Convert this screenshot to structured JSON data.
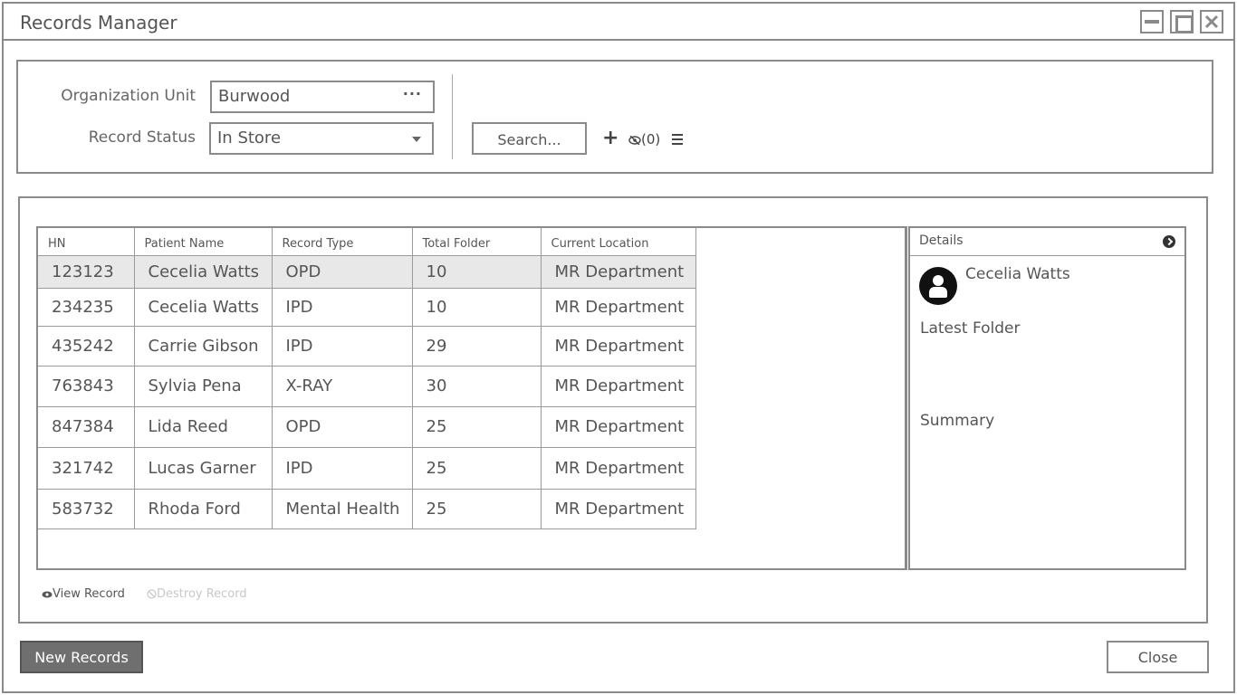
{
  "window": {
    "title": "Records Manager"
  },
  "filters": {
    "org_unit_label": "Organization Unit",
    "org_unit_value": "Burwood",
    "record_status_label": "Record Status",
    "record_status_value": "In Store",
    "search_label": "Search...",
    "hidden_count": "(0)"
  },
  "grid": {
    "columns": [
      "HN",
      "Patient Name",
      "Record Type",
      "Total Folder",
      "Current Location"
    ],
    "rows": [
      {
        "hn": "123123",
        "name": "Cecelia Watts",
        "type": "OPD",
        "folders": "10",
        "location": "MR Department",
        "selected": true
      },
      {
        "hn": "234235",
        "name": "Cecelia Watts",
        "type": "IPD",
        "folders": "10",
        "location": "MR Department"
      },
      {
        "hn": "435242",
        "name": "Carrie Gibson",
        "type": "IPD",
        "folders": "29",
        "location": "MR Department"
      },
      {
        "hn": "763843",
        "name": "Sylvia Pena",
        "type": "X-RAY",
        "folders": "30",
        "location": "MR Department"
      },
      {
        "hn": "847384",
        "name": "Lida Reed",
        "type": "OPD",
        "folders": "25",
        "location": "MR Department"
      },
      {
        "hn": "321742",
        "name": "Lucas Garner",
        "type": "IPD",
        "folders": "25",
        "location": "MR Department"
      },
      {
        "hn": "583732",
        "name": "Rhoda Ford",
        "type": "Mental Health",
        "folders": "25",
        "location": "MR Department"
      }
    ]
  },
  "details": {
    "header": "Details",
    "name": "Cecelia Watts",
    "latest_folder_label": "Latest Folder",
    "summary_label": "Summary"
  },
  "actions": {
    "view_record": "View Record",
    "destroy_record": "Destroy Record"
  },
  "footer": {
    "new_records": "New Records",
    "close": "Close"
  },
  "icons": {
    "minimize": "minimize-icon",
    "maximize": "maximize-icon",
    "close": "close-icon",
    "ellipsis": "ellipsis-icon",
    "dropdown": "chevron-down-icon",
    "add": "plus-icon",
    "hidden": "eye-slash-icon",
    "menu": "menu-icon",
    "expand": "chevron-right-circle-icon",
    "avatar": "user-avatar-icon",
    "view": "eye-icon",
    "destroy": "ban-icon"
  }
}
